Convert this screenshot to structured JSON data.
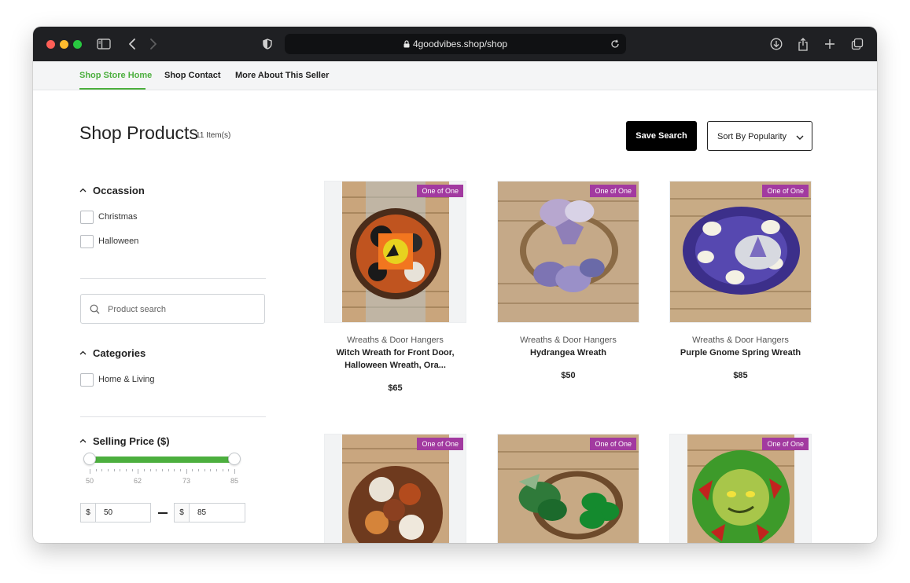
{
  "browser": {
    "url": "4goodvibes.shop/shop"
  },
  "shop_nav": {
    "items": [
      {
        "label": "Shop Store Home",
        "active": true
      },
      {
        "label": "Shop Contact",
        "active": false
      },
      {
        "label": "More About This Seller",
        "active": false
      }
    ]
  },
  "header": {
    "title": "Shop Products",
    "count": "11 Item(s)",
    "save_search_label": "Save Search",
    "sort": {
      "selected": "Sort By Popularity"
    }
  },
  "filters": {
    "occasion": {
      "title": "Occassion",
      "options": [
        "Christmas",
        "Halloween"
      ]
    },
    "search": {
      "placeholder": "Product search"
    },
    "categories": {
      "title": "Categories",
      "options": [
        "Home & Living"
      ]
    },
    "price": {
      "title": "Selling Price ($)",
      "tick_labels": [
        "50",
        "62",
        "73",
        "85"
      ],
      "range": [
        50,
        85
      ],
      "currency_symbol": "$",
      "min_value": "50",
      "max_value": "85",
      "separator": "—"
    }
  },
  "products": [
    {
      "badge": "One of One",
      "category": "Wreaths & Door Hangers",
      "title": "Witch Wreath for Front Door, Halloween Wreath, Ora...",
      "price": "$65"
    },
    {
      "badge": "One of One",
      "category": "Wreaths & Door Hangers",
      "title": "Hydrangea Wreath",
      "price": "$50"
    },
    {
      "badge": "One of One",
      "category": "Wreaths & Door Hangers",
      "title": "Purple Gnome Spring Wreath",
      "price": "$85"
    },
    {
      "badge": "One of One"
    },
    {
      "badge": "One of One"
    },
    {
      "badge": "One of One"
    }
  ],
  "colors": {
    "accent_green": "#4caf3e",
    "badge_purple": "#a23aa0",
    "titlebar": "#1f2023"
  }
}
